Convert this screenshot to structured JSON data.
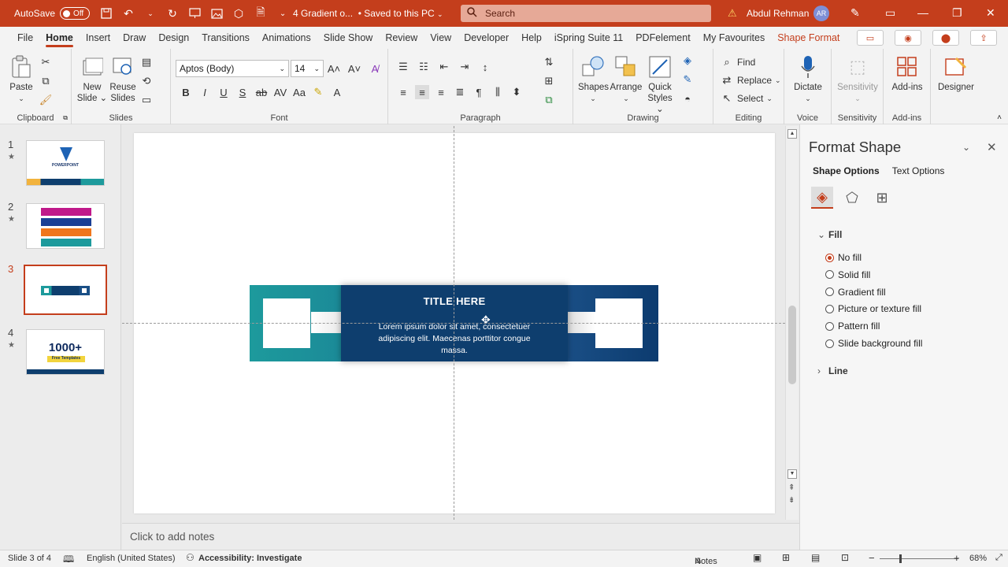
{
  "titlebar": {
    "autosave_label": "AutoSave",
    "autosave_state": "Off",
    "doc_title": "4 Gradient o...",
    "saved_status": "•  Saved to this PC",
    "search_placeholder": "Search",
    "user_name": "Abdul Rehman",
    "user_initials": "AR"
  },
  "menu": {
    "tabs": [
      "File",
      "Home",
      "Insert",
      "Draw",
      "Design",
      "Transitions",
      "Animations",
      "Slide Show",
      "Review",
      "View",
      "Developer",
      "Help",
      "iSpring Suite 11",
      "PDFelement",
      "My Favourites",
      "Shape Format"
    ],
    "active": "Home"
  },
  "ribbon": {
    "clipboard": {
      "paste": "Paste",
      "label": "Clipboard"
    },
    "slides": {
      "new_slide": "New",
      "new_slide2": "Slide",
      "reuse": "Reuse",
      "reuse2": "Slides",
      "label": "Slides"
    },
    "font": {
      "family": "Aptos (Body)",
      "size": "14",
      "label": "Font"
    },
    "paragraph": {
      "label": "Paragraph"
    },
    "drawing": {
      "shapes": "Shapes",
      "arrange": "Arrange",
      "quick": "Quick",
      "styles": "Styles",
      "label": "Drawing"
    },
    "editing": {
      "find": "Find",
      "replace": "Replace",
      "select": "Select",
      "label": "Editing"
    },
    "voice": {
      "dictate": "Dictate",
      "label": "Voice"
    },
    "sensitivity": {
      "btn": "Sensitivity",
      "label": "Sensitivity"
    },
    "addins": {
      "btn": "Add-ins",
      "label": "Add-ins"
    },
    "designer": {
      "btn": "Designer"
    }
  },
  "thumbnails": [
    {
      "num": "1",
      "star": "★"
    },
    {
      "num": "2",
      "star": "★"
    },
    {
      "num": "3",
      "star": ""
    },
    {
      "num": "4",
      "star": "★"
    }
  ],
  "thumb_texts": {
    "t1": "POWERPOINT",
    "t4": "1000+",
    "t4b": "Free Templates"
  },
  "slide": {
    "title": "TITLE HERE",
    "body": "Lorem ipsum dolor sit amet, consectetuer adipiscing elit. Maecenas porttitor congue massa."
  },
  "notes_placeholder": "Click to add notes",
  "pane": {
    "title": "Format Shape",
    "tabs": [
      "Shape Options",
      "Text Options"
    ],
    "fill_section": "Fill",
    "fill_options": [
      "No fill",
      "Solid fill",
      "Gradient fill",
      "Picture or texture fill",
      "Pattern fill",
      "Slide background fill"
    ],
    "selected_fill": "No fill",
    "line_section": "Line"
  },
  "status": {
    "slide_info": "Slide 3 of 4",
    "language": "English (United States)",
    "accessibility": "Accessibility: Investigate",
    "notes": "Notes",
    "zoom": "68%"
  },
  "colors": {
    "accent": "#c43e1c",
    "teal": "#1d9a9c",
    "navy": "#0e3e6e"
  }
}
